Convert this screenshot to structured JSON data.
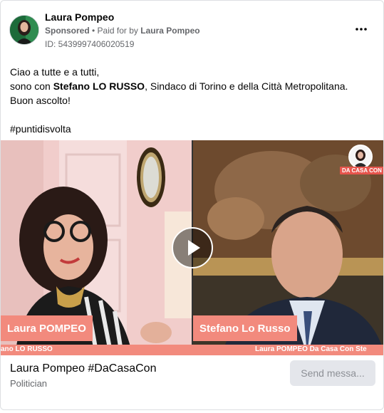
{
  "post": {
    "page_name": "Laura Pompeo",
    "sponsored_label": "Sponsored",
    "paid_prefix": " • Paid for by ",
    "paid_by": "Laura Pompeo",
    "ad_id": "ID: 5439997406020519",
    "more_icon": "more-horizontal-icon",
    "text": {
      "line1": "Ciao a tutte e a tutti,",
      "line2_prefix": "sono con ",
      "line2_bold": "Stefano LO RUSSO",
      "line2_suffix": ", Sindaco di Torino e della Città Metropolitana.",
      "line3": "Buon ascolto!",
      "hashtag": "#puntidisvolta"
    }
  },
  "video": {
    "left_name_tag": "Laura POMPEO",
    "right_name_tag": "Stefano Lo Russo",
    "ticker_left": "ano LO RUSSO",
    "ticker_right": "Laura POMPEO Da Casa Con Ste",
    "logo_label": "DA CASA CON",
    "play_icon": "play-icon",
    "accent_color": "#f28a7d"
  },
  "footer": {
    "title": "Laura Pompeo #DaCasaCon",
    "subtitle": "Politician",
    "send_button": "Send messa..."
  }
}
